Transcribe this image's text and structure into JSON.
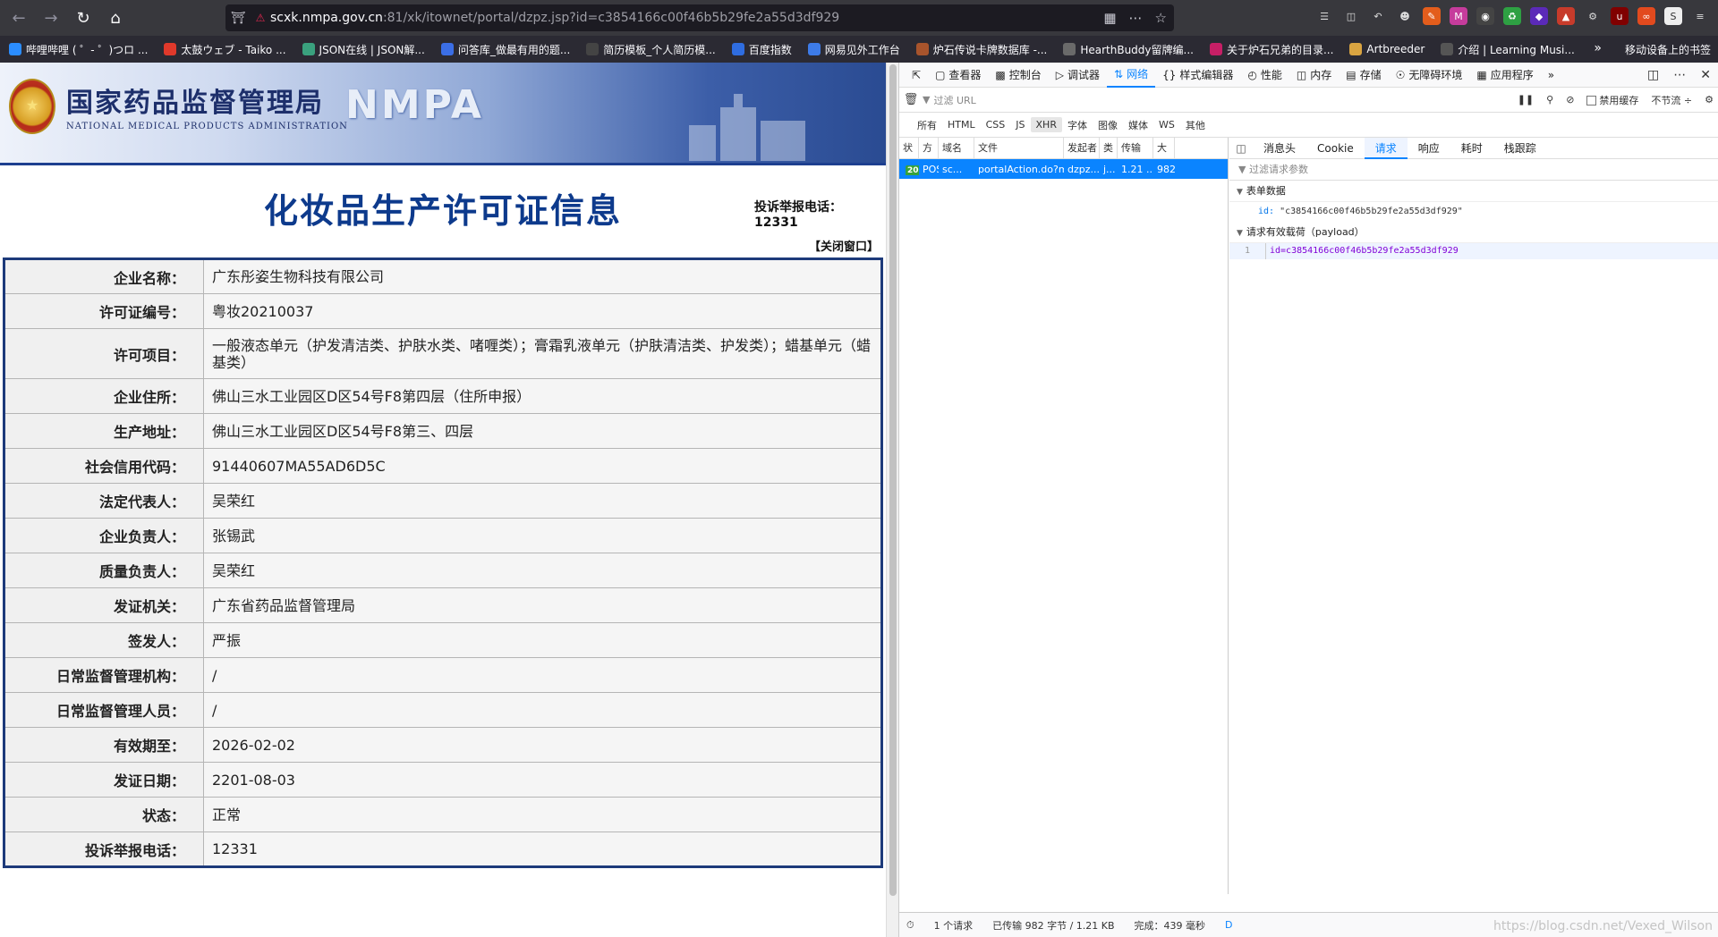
{
  "browser": {
    "url_host": "scxk.nmpa.gov.cn",
    "url_rest": ":81/xk/itownet/portal/dzpz.jsp?id=c3854166c00f46b5b29fe2a55d3df929"
  },
  "bookmarks": [
    {
      "label": "哔哩哔哩 ( ゜- ゜)つロ ...",
      "color": "#2b8dff"
    },
    {
      "label": "太鼓ウェブ - Taiko ...",
      "color": "#e0392b"
    },
    {
      "label": "JSON在线 | JSON解...",
      "color": "#3aa17e"
    },
    {
      "label": "问答库_做最有用的题...",
      "color": "#3b6ee6"
    },
    {
      "label": "简历模板_个人简历模...",
      "color": "#444444"
    },
    {
      "label": "百度指数",
      "color": "#2f6de0"
    },
    {
      "label": "网易见外工作台",
      "color": "#3d7be8"
    },
    {
      "label": "炉石传说卡牌数据库 -...",
      "color": "#a8542c"
    },
    {
      "label": "HearthBuddy留牌编...",
      "color": "#6a6a6a"
    },
    {
      "label": "关于炉石兄弟的目录...",
      "color": "#c71f66"
    },
    {
      "label": "Artbreeder",
      "color": "#d9a441"
    },
    {
      "label": "介绍 | Learning Musi...",
      "color": "#555555"
    }
  ],
  "bookmarks_mobile": "移动设备上的书签",
  "banner": {
    "cn": "国家药品监督管理局",
    "en": "NATIONAL MEDICAL PRODUCTS ADMINISTRATION",
    "abbr": "NMPA"
  },
  "page": {
    "title": "化妆品生产许可证信息",
    "hotline": "投诉举报电话：  12331",
    "close": "【关闭窗口】"
  },
  "rows": [
    {
      "label": "企业名称：",
      "value": "广东彤姿生物科技有限公司"
    },
    {
      "label": "许可证编号：",
      "value": "粤妆20210037"
    },
    {
      "label": "许可项目：",
      "value": "一般液态单元（护发清洁类、护肤水类、啫喱类）；膏霜乳液单元（护肤清洁类、护发类）；蜡基单元（蜡基类）"
    },
    {
      "label": "企业住所：",
      "value": "佛山三水工业园区D区54号F8第四层（住所申报）"
    },
    {
      "label": "生产地址：",
      "value": "佛山三水工业园区D区54号F8第三、四层"
    },
    {
      "label": "社会信用代码：",
      "value": "91440607MA55AD6D5C"
    },
    {
      "label": "法定代表人：",
      "value": "吴荣红"
    },
    {
      "label": "企业负责人：",
      "value": "张锡武"
    },
    {
      "label": "质量负责人：",
      "value": "吴荣红"
    },
    {
      "label": "发证机关：",
      "value": "广东省药品监督管理局"
    },
    {
      "label": "签发人：",
      "value": "严振"
    },
    {
      "label": "日常监督管理机构：",
      "value": "/"
    },
    {
      "label": "日常监督管理人员：",
      "value": "/"
    },
    {
      "label": "有效期至：",
      "value": "2026-02-02"
    },
    {
      "label": "发证日期：",
      "value": "2201-08-03"
    },
    {
      "label": "状态：",
      "value": "正常"
    },
    {
      "label": "投诉举报电话：",
      "value": "12331"
    }
  ],
  "devtools": {
    "tabs": [
      "查看器",
      "控制台",
      "调试器",
      "网络",
      "样式编辑器",
      "性能",
      "内存",
      "存储",
      "无障碍环境",
      "应用程序"
    ],
    "filter_placeholder": "过滤 URL",
    "disable_cache": "禁用缓存",
    "throttle": "不节流 ÷",
    "types": [
      "所有",
      "HTML",
      "CSS",
      "JS",
      "XHR",
      "字体",
      "图像",
      "媒体",
      "WS",
      "其他"
    ],
    "columns": [
      "状",
      "方",
      "域名",
      "文件",
      "发起者",
      "类",
      "传输",
      "大"
    ],
    "request": {
      "status": "200",
      "method": "POS",
      "domain": "sc...",
      "file": "portalAction.do?meth",
      "initiator": "dzpz....",
      "type": "j...",
      "transferred": "1.21 ...",
      "size": "982"
    },
    "detail_tabs": [
      "消息头",
      "Cookie",
      "请求",
      "响应",
      "耗时",
      "栈跟踪"
    ],
    "detail_filter": "过滤请求参数",
    "form_section": "表单数据",
    "form_key": "id:",
    "form_value": "\"c3854166c00f46b5b29fe2a55d3df929\"",
    "payload_section": "请求有效载荷（payload）",
    "payload_line_no": "1",
    "payload_code": "id=c3854166c00f46b5b29fe2a55d3df929",
    "status_requests": "1 个请求",
    "status_transferred": "已传输 982 字节 / 1.21 KB",
    "status_finished": "完成：439 毫秒",
    "status_d": "D"
  },
  "watermark": "https://blog.csdn.net/Vexed_Wilson",
  "colors": {
    "accent": "#0a84ff",
    "title_blue": "#0d3a8c",
    "table_border": "#1d3a7a"
  }
}
